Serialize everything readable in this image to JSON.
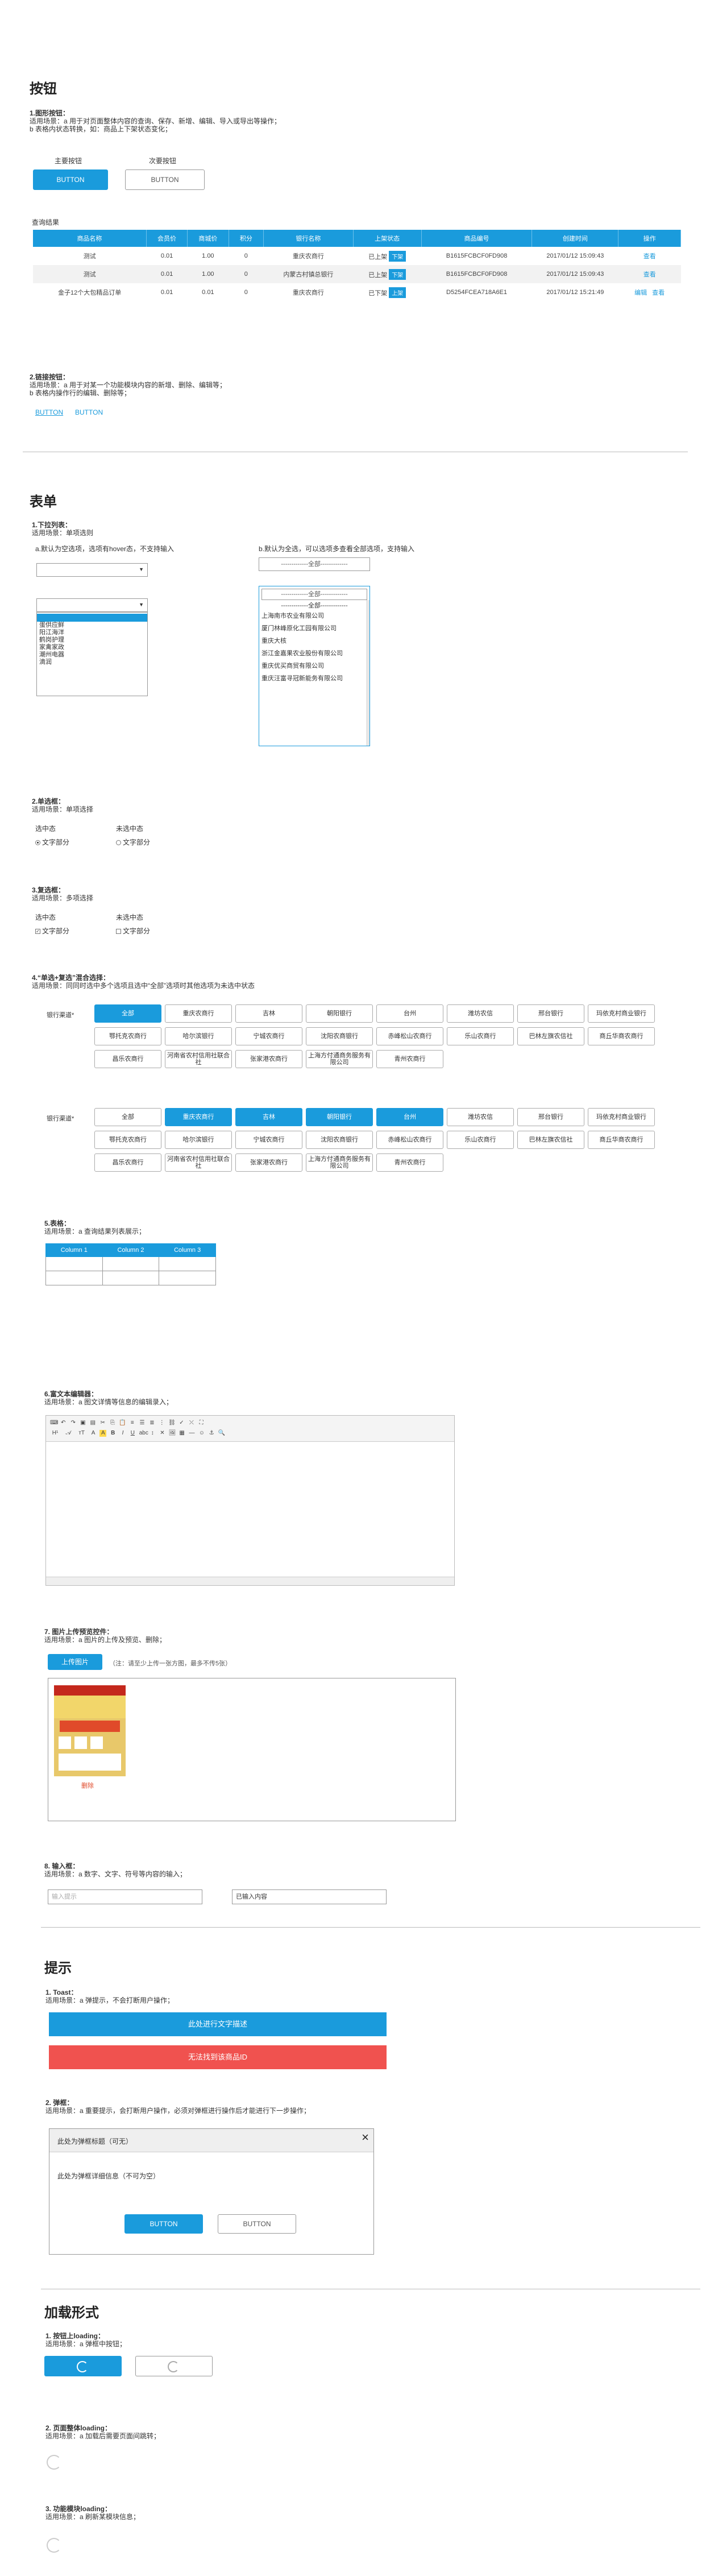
{
  "buttons_section": {
    "title": "按钮",
    "sub1_title": "1.图形按钮：",
    "sub1_desc": "适用场景：a  用于对页面整体内容的查询、保存、新增、编辑、导入或导出等操作；\n           b  表格内状态转换，如：商品上下架状态变化；",
    "primary_caption": "主要按钮",
    "primary_label": "BUTTON",
    "secondary_caption": "次要按钮",
    "secondary_label": "BUTTON",
    "query_result_title": "查询结果",
    "table_headers": [
      "商品名称",
      "会员价",
      "商城价",
      "积分",
      "银行名称",
      "上架状态",
      "商品编号",
      "创建时间",
      "操作"
    ],
    "table_rows": [
      {
        "name": "测试",
        "member": "0.01",
        "mall": "1.00",
        "points": "0",
        "bank": "重庆农商行",
        "status": "已上架",
        "tag": "下架",
        "code": "B1615FCBCF0FD908",
        "time": "2017/01/12 15:09:43",
        "ops": [
          "查看"
        ]
      },
      {
        "name": "测试",
        "member": "0.01",
        "mall": "1.00",
        "points": "0",
        "bank": "内蒙古村镇总银行",
        "status": "已上架",
        "tag": "下架",
        "code": "B1615FCBCF0FD908",
        "time": "2017/01/12 15:09:43",
        "ops": [
          "查看"
        ]
      },
      {
        "name": "金子12个大包精品订单",
        "member": "0.01",
        "mall": "0.01",
        "points": "0",
        "bank": "重庆农商行",
        "status": "已下架",
        "tag": "上架",
        "code": "D5254FCEA718A6E1",
        "time": "2017/01/12 15:21:49",
        "ops": [
          "编辑",
          "查看"
        ]
      }
    ],
    "sub2_title": "2.链接按钮：",
    "sub2_desc": "适用场景：a  用于对某一个功能模块内容的新增、删除、编辑等；\n           b  表格内操作行的编辑、删除等；",
    "link1": "BUTTON",
    "link2": "BUTTON"
  },
  "form_section": {
    "title": "表单",
    "dropdown_title": "1.下拉列表：",
    "dropdown_desc": "适用场景：单项选则",
    "dropdown_a": "a.默认为空选项，选项有hover态，不支持输入",
    "dropdown_b": "b.默认为全选，可以选项多查看全部选项，支持输入",
    "select_all": "-------------全部-------------",
    "list_a": [
      "",
      "蛋供应鲜",
      "阳江海洋",
      "鹤岗护理",
      "家禽家政",
      "潮州电器",
      "滴润"
    ],
    "list_b": [
      "-------------全部-------------",
      "上海南市农业有限公司",
      "厦门林峰原化工园有限公司",
      "重庆大核",
      "浙江金嘉果农业股份有限公司",
      "重庆优买商贸有限公司",
      "重庆汪富寻冠新能务有限公司"
    ],
    "radio_title": "2.单选框：",
    "radio_desc": "适用场景：单项选择",
    "selected_state": "选中态",
    "unselected_state": "未选中态",
    "text_part": "文字部分",
    "checkbox_title": "3.复选框：",
    "checkbox_desc": "适用场景：多项选择",
    "combo_title": "4.“单选+复选”混合选择：",
    "combo_desc": "适用场景：同同时选中多个选项且选中“全部”选项时其他选项为未选中状态",
    "bank_label": "银行渠道*",
    "banks_row1": [
      "全部",
      "重庆农商行",
      "吉林",
      "朝阳银行",
      "台州",
      "潍坊农信",
      "邢台银行",
      "玛依克村商业银行"
    ],
    "banks_row2": [
      "鄂托克农商行",
      "哈尔滨银行",
      "宁城农商行",
      "沈阳农商银行",
      "赤峰松山农商行",
      "乐山农商行",
      "巴林左旗农信社",
      "商丘华商农商行"
    ],
    "banks_row3": [
      "昌乐农商行",
      "河南省农村信用社联合社",
      "张家港农商行",
      "上海方付通商务服务有限公司",
      "青州农商行"
    ],
    "table_title": "5.表格：",
    "table_desc": "适用场景：a  查询结果列表展示；",
    "table_columns": [
      "Column 1",
      "Column 2",
      "Column 3"
    ],
    "editor_title": "6.富文本编辑器：",
    "editor_desc": "适用场景：a  图文详情等信息的编辑录入；",
    "upload_title": "7. 图片上传预览控件：",
    "upload_desc": "适用场景：a  图片的上传及预览、删除；",
    "upload_button": "上传图片",
    "upload_note": "（注：请至少上传一张方图，最多不传5张）",
    "delete_label": "删除",
    "input_title": "8. 输入框：",
    "input_desc": "适用场景：a  数字、文字、符号等内容的输入；",
    "input_placeholder": "输入提示",
    "input_value": "已输入内容"
  },
  "tips_section": {
    "title": "提示",
    "toast_title": "1. Toast：",
    "toast_desc": "适用场景：a  弹提示，不会打断用户操作；",
    "toast_blue": "此处进行文字描述",
    "toast_red": "无法找到该商品ID",
    "dialog_title": "2. 弹框：",
    "dialog_desc": "适用场景：a  重要提示，会打断用户操作，必须对弹框进行操作后才能进行下一步操作；",
    "dialog_header": "此处为弹框标题（可无）",
    "dialog_body": "此处为弹框详细信息（不可为空）",
    "dialog_ok": "BUTTON",
    "dialog_cancel": "BUTTON",
    "close_glyph": "×"
  },
  "loading_section": {
    "title": "加载形式",
    "l1_title": "1. 按钮上loading：",
    "l1_desc": "适用场景：a  弹框中按钮；",
    "l2_title": "2. 页面整体loading：",
    "l2_desc": "适用场景：a  加载后需要页面间跳转；",
    "l3_title": "3. 功能模块loading：",
    "l3_desc": "适用场景：a  刷新某模块信息；"
  },
  "colors": {
    "accent": "#1a9bdc",
    "danger": "#f0524f"
  }
}
